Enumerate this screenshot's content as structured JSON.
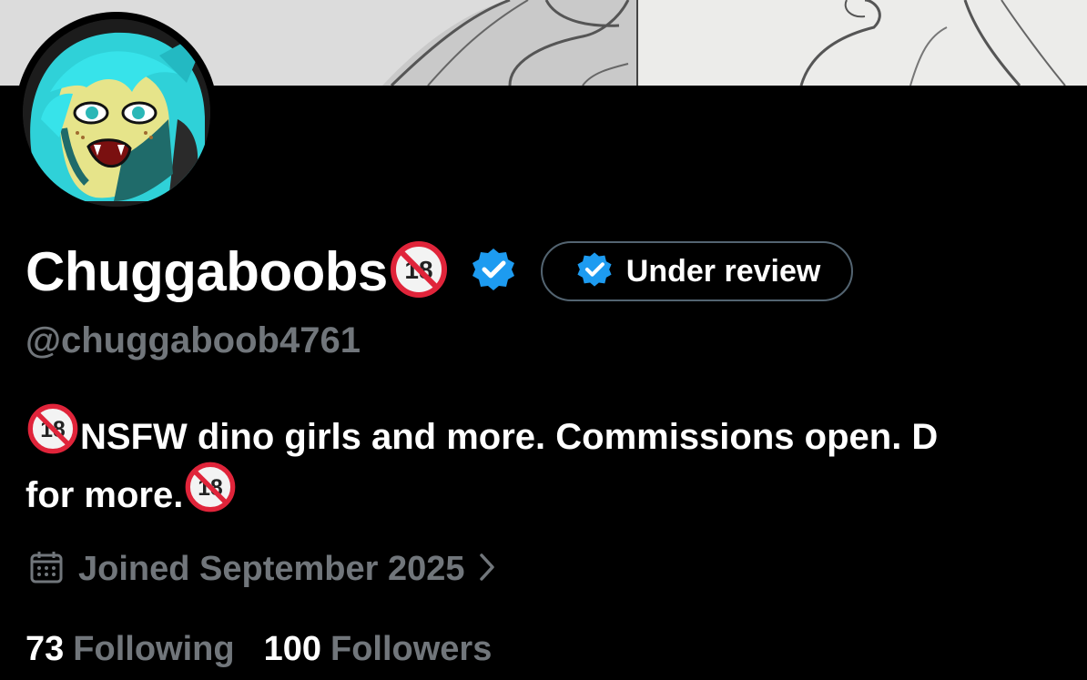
{
  "profile": {
    "display_name": "Chuggaboobs",
    "handle": "@chuggaboob4761",
    "verification_status": "Under review",
    "bio_line1": "NSFW dino girls and more. Commissions open. D",
    "bio_line2": "for more.",
    "joined": "Joined September 2025",
    "following_count": "73",
    "following_label": "Following",
    "followers_count": "100",
    "followers_label": "Followers"
  },
  "icons": {
    "age_badge": "no-under-18-icon",
    "verified": "verified-badge-icon",
    "calendar": "calendar-icon",
    "chevron": "chevron-right-icon"
  },
  "colors": {
    "background": "#000000",
    "verified_blue": "#1d9bf0",
    "muted_text": "#71767b",
    "age_badge_red": "#e0243a"
  }
}
